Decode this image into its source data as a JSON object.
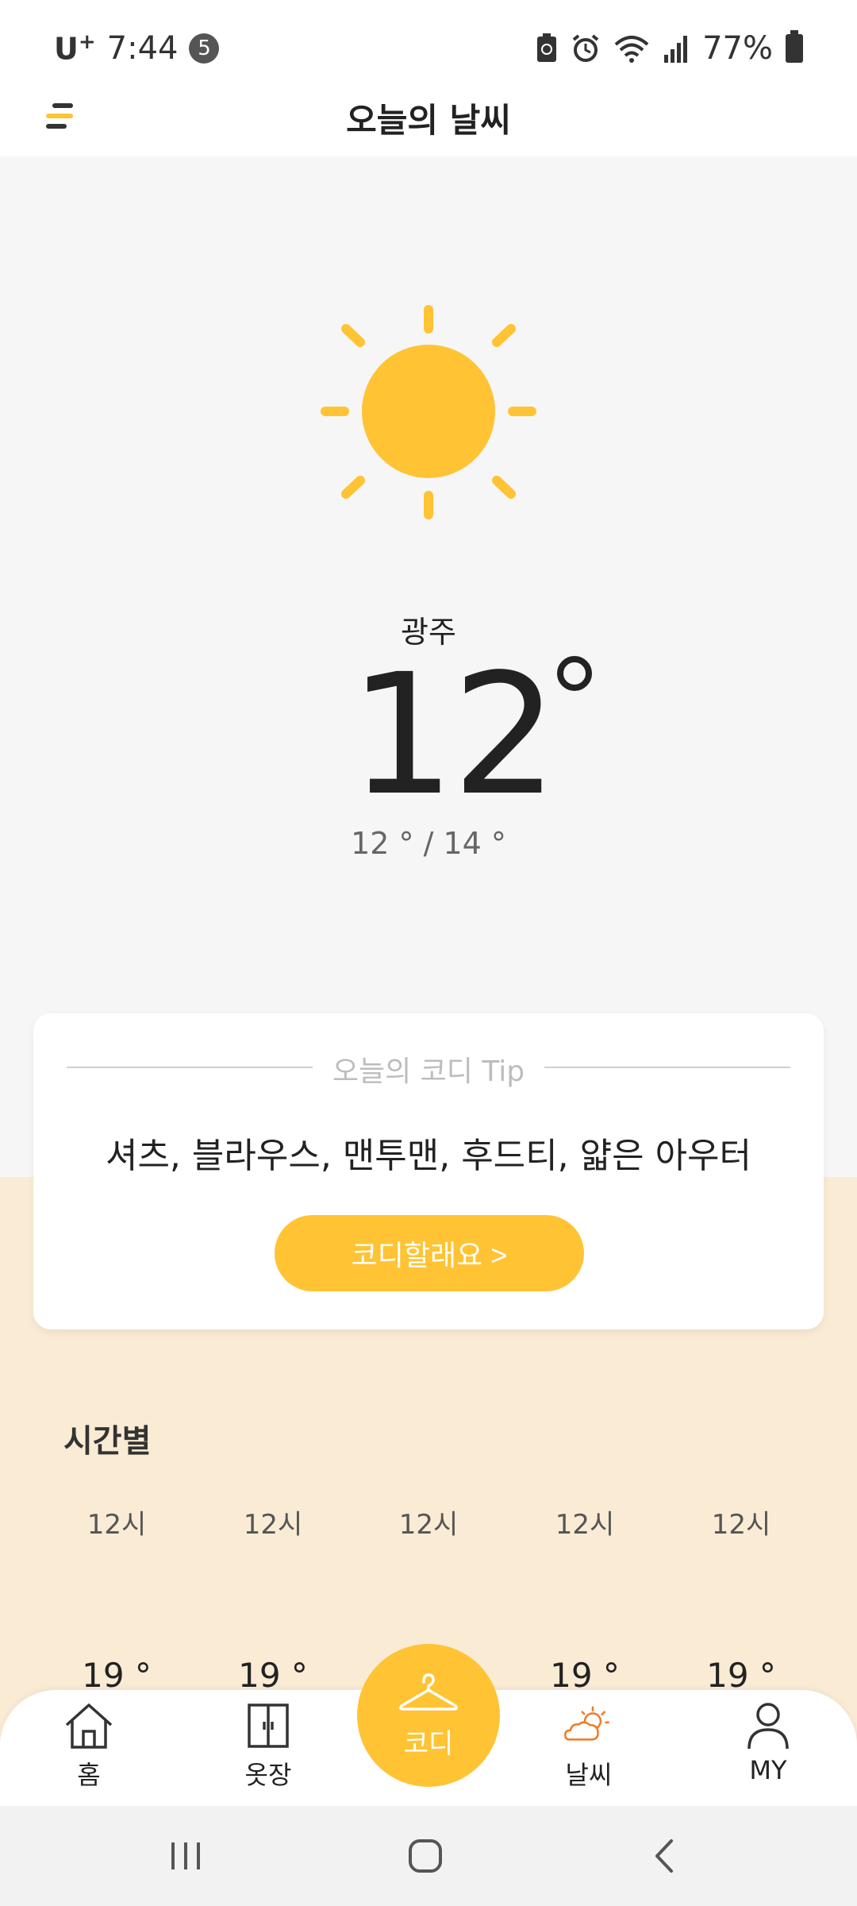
{
  "status_bar": {
    "carrier": "U",
    "carrier_sup": "+",
    "time": "7:44",
    "notification_count": "5",
    "battery": "77%"
  },
  "header": {
    "title": "오늘의 날씨",
    "menu_icon": "menu-icon"
  },
  "weather": {
    "icon": "sun-icon",
    "city": "광주",
    "temperature": "12",
    "min_max": "12 ° / 14 °"
  },
  "tip": {
    "title": "오늘의 코디 Tip",
    "clothes": "셔츠, 블라우스, 맨투맨, 후드티, 얇은 아우터",
    "button_label": "코디할래요 >"
  },
  "hourly": {
    "title": "시간별",
    "items": [
      {
        "hour": "12시",
        "temp": "19 °"
      },
      {
        "hour": "12시",
        "temp": "19 °"
      },
      {
        "hour": "12시",
        "temp": ""
      },
      {
        "hour": "12시",
        "temp": "19 °"
      },
      {
        "hour": "12시",
        "temp": "19 °"
      }
    ]
  },
  "bottom_nav": {
    "home": "홈",
    "closet": "옷장",
    "coordi": "코디",
    "weather": "날씨",
    "my": "MY"
  },
  "colors": {
    "accent": "#ffc334",
    "cream": "#faebd5",
    "weather_icon": "#f07a21"
  }
}
